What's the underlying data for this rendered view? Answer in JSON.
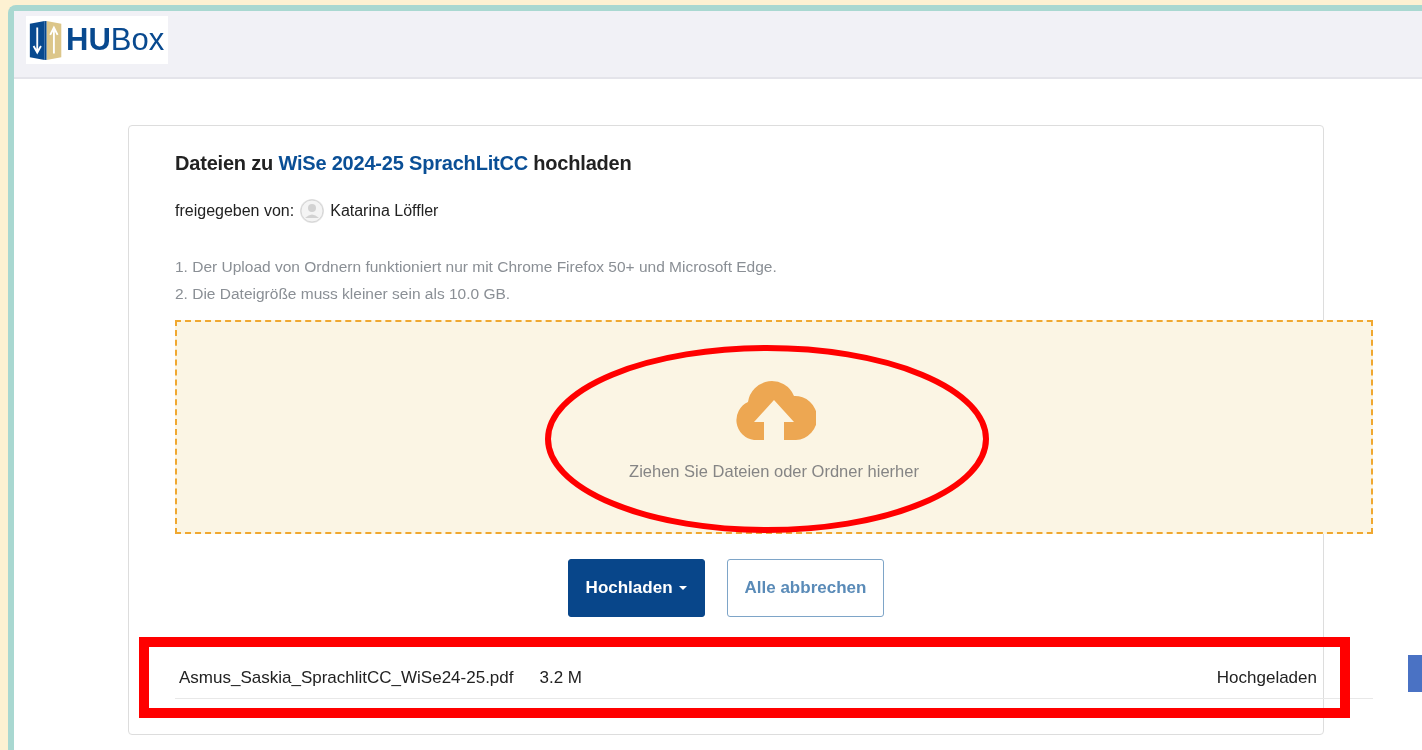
{
  "header": {
    "logo": {
      "bold": "HU",
      "light": "Box"
    }
  },
  "upload": {
    "title": {
      "before": "Dateien zu ",
      "link": "WiSe 2024-25 SprachLitCC",
      "after": " hochladen"
    },
    "shared_by": {
      "label": "freigegeben von:",
      "name": "Katarina Löffler"
    },
    "notes": [
      "1. Der Upload von Ordnern funktioniert nur mit Chrome Firefox 50+ und Microsoft Edge.",
      "2. Die Dateigröße muss kleiner sein als 10.0 GB."
    ],
    "dropzone": {
      "text": "Ziehen Sie Dateien oder Ordner hierher",
      "highlighted": true
    },
    "buttons": [
      {
        "kind": "primary",
        "label": "Hochladen",
        "caret": true
      },
      {
        "kind": "outline",
        "label": "Alle abbrechen",
        "caret": false
      }
    ],
    "files": [
      {
        "name": "Asmus_Saskia_SprachlitCC_WiSe24-25.pdf",
        "size": "3.2 M",
        "status": "Hochgeladen",
        "highlighted": true
      }
    ]
  }
}
